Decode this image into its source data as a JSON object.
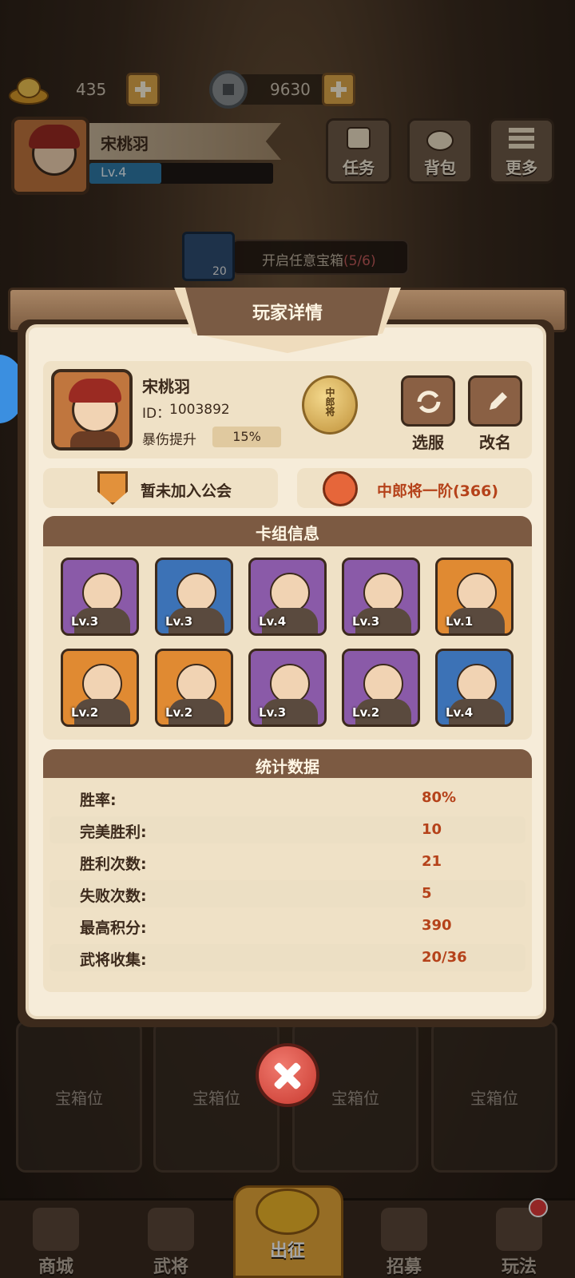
{
  "currency": {
    "gold": "435",
    "coins": "9630"
  },
  "header": {
    "player_name": "宋桃羽",
    "level": "Lv.4",
    "level_progress": 0.39,
    "buttons": [
      {
        "label": "任务",
        "icon": "scroll-icon"
      },
      {
        "label": "背包",
        "icon": "bag-icon"
      },
      {
        "label": "更多",
        "icon": "menu-icon"
      }
    ]
  },
  "quest": {
    "label": "开启任意宝箱",
    "progress": "(5/6)",
    "count": "20"
  },
  "modal": {
    "title": "玩家详情",
    "player": {
      "name": "宋桃羽",
      "id_label": "ID：",
      "id": "1003892",
      "crit_label": "暴伤提升",
      "crit_value": "15%",
      "rank_badge": "中郎将"
    },
    "actions": {
      "change_server": "选服",
      "rename": "改名"
    },
    "guild": "暂未加入公会",
    "rank": "中郎将一阶(366)",
    "deck": {
      "title": "卡组信息",
      "heroes": [
        {
          "level": "Lv.3",
          "rarity": "purple"
        },
        {
          "level": "Lv.3",
          "rarity": "blue"
        },
        {
          "level": "Lv.4",
          "rarity": "purple"
        },
        {
          "level": "Lv.3",
          "rarity": "purple"
        },
        {
          "level": "Lv.1",
          "rarity": "orange"
        },
        {
          "level": "Lv.2",
          "rarity": "orange"
        },
        {
          "level": "Lv.2",
          "rarity": "orange"
        },
        {
          "level": "Lv.3",
          "rarity": "purple"
        },
        {
          "level": "Lv.2",
          "rarity": "purple"
        },
        {
          "level": "Lv.4",
          "rarity": "blue"
        }
      ]
    },
    "stats": {
      "title": "统计数据",
      "rows": [
        {
          "label": "胜率:",
          "value": "80%"
        },
        {
          "label": "完美胜利:",
          "value": "10"
        },
        {
          "label": "胜利次数:",
          "value": "21"
        },
        {
          "label": "失败次数:",
          "value": "5"
        },
        {
          "label": "最高积分:",
          "value": "390"
        },
        {
          "label": "武将收集:",
          "value": "20/36"
        }
      ]
    }
  },
  "chest_slots": [
    "宝箱位",
    "宝箱位",
    "宝箱位",
    "宝箱位"
  ],
  "nav": [
    {
      "label": "商城",
      "icon": "shop-icon"
    },
    {
      "label": "武将",
      "icon": "helmet-icon"
    },
    {
      "label": "出征",
      "icon": "battle-icon"
    },
    {
      "label": "招募",
      "icon": "recruit-icon"
    },
    {
      "label": "玩法",
      "icon": "temple-icon"
    }
  ],
  "colors": {
    "accent": "#7c5a42",
    "highlight": "#b5421a",
    "panel": "#f6ecd9"
  }
}
